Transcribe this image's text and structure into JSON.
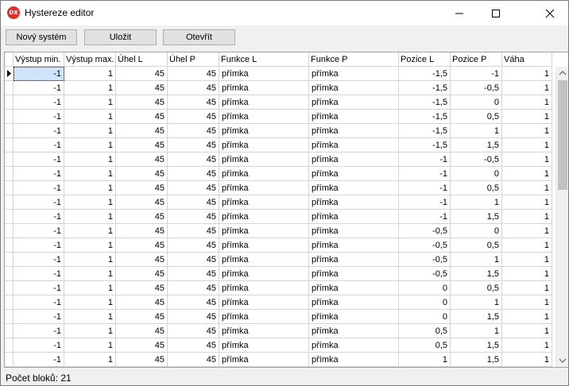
{
  "window": {
    "title": "Hystereze editor",
    "app_icon_text": "DX"
  },
  "toolbar": {
    "new_label": "Nový systém",
    "save_label": "Uložit",
    "open_label": "Otevřít"
  },
  "grid": {
    "columns": [
      "Výstup min.",
      "Výstup max.",
      "Úhel L",
      "Úhel P",
      "Funkce L",
      "Funkce P",
      "Pozice L",
      "Pozice P",
      "Váha"
    ],
    "rows": [
      [
        "-1",
        "1",
        "45",
        "45",
        "přímka",
        "přímka",
        "-1,5",
        "-1",
        "1"
      ],
      [
        "-1",
        "1",
        "45",
        "45",
        "přímka",
        "přímka",
        "-1,5",
        "-0,5",
        "1"
      ],
      [
        "-1",
        "1",
        "45",
        "45",
        "přímka",
        "přímka",
        "-1,5",
        "0",
        "1"
      ],
      [
        "-1",
        "1",
        "45",
        "45",
        "přímka",
        "přímka",
        "-1,5",
        "0,5",
        "1"
      ],
      [
        "-1",
        "1",
        "45",
        "45",
        "přímka",
        "přímka",
        "-1,5",
        "1",
        "1"
      ],
      [
        "-1",
        "1",
        "45",
        "45",
        "přímka",
        "přímka",
        "-1,5",
        "1,5",
        "1"
      ],
      [
        "-1",
        "1",
        "45",
        "45",
        "přímka",
        "přímka",
        "-1",
        "-0,5",
        "1"
      ],
      [
        "-1",
        "1",
        "45",
        "45",
        "přímka",
        "přímka",
        "-1",
        "0",
        "1"
      ],
      [
        "-1",
        "1",
        "45",
        "45",
        "přímka",
        "přímka",
        "-1",
        "0,5",
        "1"
      ],
      [
        "-1",
        "1",
        "45",
        "45",
        "přímka",
        "přímka",
        "-1",
        "1",
        "1"
      ],
      [
        "-1",
        "1",
        "45",
        "45",
        "přímka",
        "přímka",
        "-1",
        "1,5",
        "1"
      ],
      [
        "-1",
        "1",
        "45",
        "45",
        "přímka",
        "přímka",
        "-0,5",
        "0",
        "1"
      ],
      [
        "-1",
        "1",
        "45",
        "45",
        "přímka",
        "přímka",
        "-0,5",
        "0,5",
        "1"
      ],
      [
        "-1",
        "1",
        "45",
        "45",
        "přímka",
        "přímka",
        "-0,5",
        "1",
        "1"
      ],
      [
        "-1",
        "1",
        "45",
        "45",
        "přímka",
        "přímka",
        "-0,5",
        "1,5",
        "1"
      ],
      [
        "-1",
        "1",
        "45",
        "45",
        "přímka",
        "přímka",
        "0",
        "0,5",
        "1"
      ],
      [
        "-1",
        "1",
        "45",
        "45",
        "přímka",
        "přímka",
        "0",
        "1",
        "1"
      ],
      [
        "-1",
        "1",
        "45",
        "45",
        "přímka",
        "přímka",
        "0",
        "1,5",
        "1"
      ],
      [
        "-1",
        "1",
        "45",
        "45",
        "přímka",
        "přímka",
        "0,5",
        "1",
        "1"
      ],
      [
        "-1",
        "1",
        "45",
        "45",
        "přímka",
        "přímka",
        "0,5",
        "1,5",
        "1"
      ],
      [
        "-1",
        "1",
        "45",
        "45",
        "přímka",
        "přímka",
        "1",
        "1,5",
        "1"
      ]
    ],
    "selected_row": 0,
    "selected_col": 0
  },
  "status": {
    "text": "Počet bloků: 21"
  },
  "colors": {
    "selection": "#cfe3fb",
    "grid_line": "#d4d4d4",
    "app_icon": "#d9322e"
  },
  "icons": {
    "minimize": "minimize-icon",
    "maximize": "maximize-icon",
    "close": "close-icon",
    "row_indicator": "row-pointer-icon"
  }
}
